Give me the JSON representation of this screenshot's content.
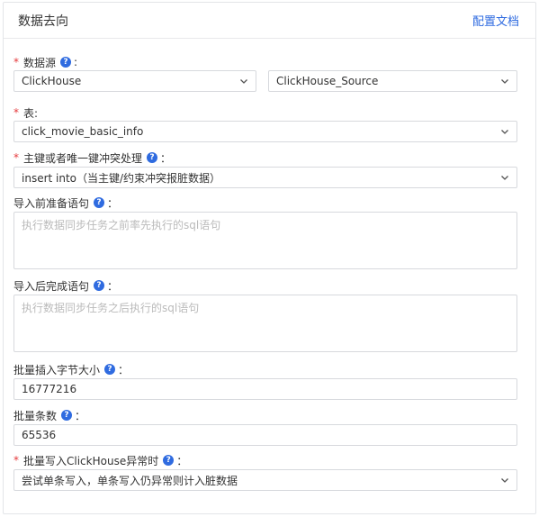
{
  "header": {
    "title": "数据去向",
    "doc_link": "配置文档"
  },
  "fields": {
    "datasource": {
      "label": "数据源",
      "required": true,
      "type_value": "ClickHouse",
      "source_value": "ClickHouse_Source"
    },
    "table": {
      "label": "表:",
      "required": true,
      "value": "click_movie_basic_info"
    },
    "conflict": {
      "label": "主键或者唯一键冲突处理",
      "required": true,
      "value": "insert into（当主键/约束冲突报脏数据）"
    },
    "pre_sql": {
      "label": "导入前准备语句",
      "placeholder": "执行数据同步任务之前率先执行的sql语句"
    },
    "post_sql": {
      "label": "导入后完成语句",
      "placeholder": "执行数据同步任务之后执行的sql语句"
    },
    "batch_bytes": {
      "label": "批量插入字节大小",
      "value": "16777216"
    },
    "batch_count": {
      "label": "批量条数",
      "value": "65536"
    },
    "batch_error": {
      "label": "批量写入ClickHouse异常时",
      "required": true,
      "value": "尝试单条写入，单条写入仍异常则计入脏数据"
    }
  },
  "icons": {
    "help": "question-circle-icon",
    "dropdown": "chevron-down-icon"
  },
  "colors": {
    "accent": "#2f6be0",
    "required": "#e4393c"
  }
}
